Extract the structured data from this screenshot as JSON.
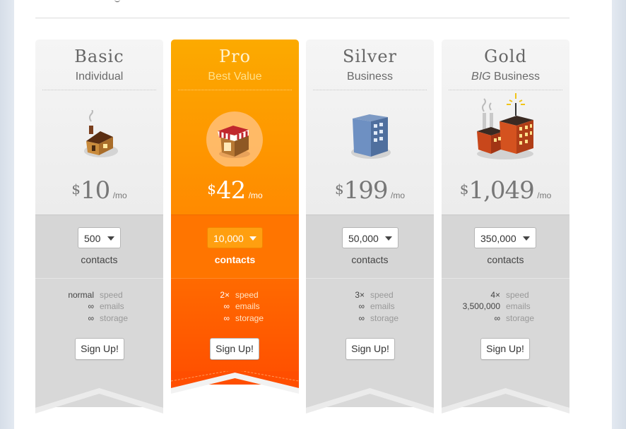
{
  "plans": [
    {
      "name": "Basic",
      "subtitle": "Individual",
      "currency": "$",
      "price": "10",
      "per": "/mo",
      "contacts_value": "500",
      "contacts_label": "contacts",
      "features": [
        {
          "k": "normal",
          "v": "speed"
        },
        {
          "k": "∞",
          "v": "emails"
        },
        {
          "k": "∞",
          "v": "storage"
        }
      ],
      "cta": "Sign Up!",
      "icon": "house-icon"
    },
    {
      "name": "Pro",
      "subtitle": "Best Value",
      "currency": "$",
      "price": "42",
      "per": "/mo",
      "contacts_value": "10,000",
      "contacts_label": "contacts",
      "features": [
        {
          "k": "2×",
          "v": "speed"
        },
        {
          "k": "∞",
          "v": "emails"
        },
        {
          "k": "∞",
          "v": "storage"
        }
      ],
      "cta": "Sign Up!",
      "icon": "shop-icon",
      "accent": "#ff8a00"
    },
    {
      "name": "Silver",
      "subtitle": "Business",
      "currency": "$",
      "price": "199",
      "per": "/mo",
      "contacts_value": "50,000",
      "contacts_label": "contacts",
      "features": [
        {
          "k": "3×",
          "v": "speed"
        },
        {
          "k": "∞",
          "v": "emails"
        },
        {
          "k": "∞",
          "v": "storage"
        }
      ],
      "cta": "Sign Up!",
      "icon": "office-building-icon"
    },
    {
      "name": "Gold",
      "subtitle_em": "BIG",
      "subtitle": " Business",
      "currency": "$",
      "price": "1,049",
      "per": "/mo",
      "contacts_value": "350,000",
      "contacts_label": "contacts",
      "features": [
        {
          "k": "4×",
          "v": "speed"
        },
        {
          "k": "3,500,000",
          "v": "emails"
        },
        {
          "k": "∞",
          "v": "storage"
        }
      ],
      "cta": "Sign Up!",
      "icon": "factory-icon"
    }
  ]
}
